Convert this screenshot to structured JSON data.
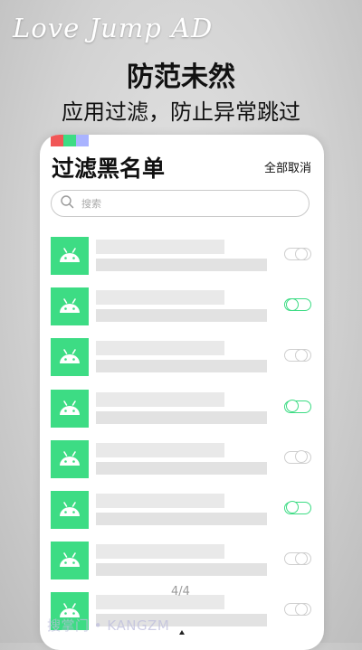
{
  "brand": "Love Jump AD",
  "headline": "防范未然",
  "subline": "应用过滤，防止异常跳过",
  "screen": {
    "title": "过滤黑名单",
    "clear_all": "全部取消",
    "search": {
      "placeholder": "搜索"
    },
    "color_dots": [
      "#f15656",
      "#3ddc84",
      "#a9b3ff"
    ],
    "accent": "#3ddc84",
    "apps": [
      {
        "enabled": false
      },
      {
        "enabled": true
      },
      {
        "enabled": false
      },
      {
        "enabled": true
      },
      {
        "enabled": false
      },
      {
        "enabled": true
      },
      {
        "enabled": false
      },
      {
        "enabled": false
      }
    ],
    "pager": "4/4",
    "watermark": "搜掌门 • KANGZM"
  }
}
